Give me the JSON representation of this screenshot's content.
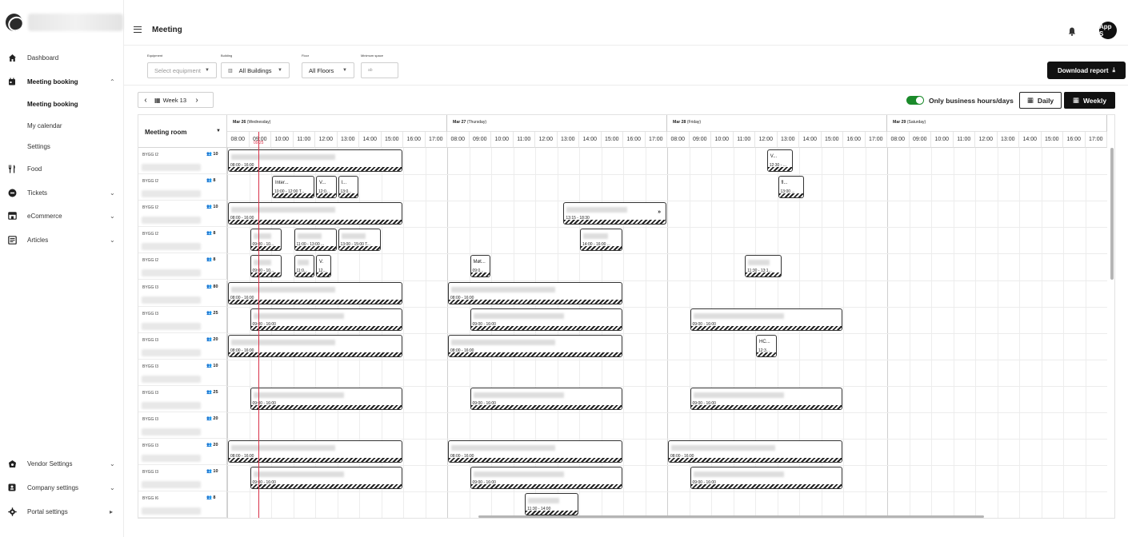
{
  "header": {
    "title": "Meeting",
    "avatar_text": "App S"
  },
  "sidebar": {
    "items": [
      {
        "label": "Dashboard",
        "icon": "home-icon",
        "chevron": ""
      },
      {
        "label": "Meeting booking",
        "icon": "calendar-icon",
        "chevron": "⌃"
      },
      {
        "label": "Meeting booking",
        "icon": "",
        "chevron": ""
      },
      {
        "label": "My calendar",
        "icon": "",
        "chevron": ""
      },
      {
        "label": "Settings",
        "icon": "",
        "chevron": ""
      },
      {
        "label": "Food",
        "icon": "utensils-icon",
        "chevron": ""
      },
      {
        "label": "Tickets",
        "icon": "ticket-icon",
        "chevron": "⌄"
      },
      {
        "label": "eCommerce",
        "icon": "store-icon",
        "chevron": "⌄"
      },
      {
        "label": "Articles",
        "icon": "articles-icon",
        "chevron": "⌄"
      },
      {
        "label": "Vendor Settings",
        "icon": "vendor-icon",
        "chevron": "⌄"
      },
      {
        "label": "Company settings",
        "icon": "company-icon",
        "chevron": "⌄"
      },
      {
        "label": "Portal settings",
        "icon": "gear-icon",
        "chevron": "▸"
      }
    ]
  },
  "filters": {
    "equipment_label": "Equipment",
    "equipment_placeholder": "Select equipment",
    "building_label": "Building",
    "building_value": "All Buildings",
    "floor_label": "Floor",
    "floor_value": "All Floors",
    "min_space_label": "Minimum space",
    "min_space_placeholder": "ab",
    "download_label": "Download report"
  },
  "toolbar": {
    "week_label": "Week 13",
    "business_hours_label": "Only business hours/days",
    "daily_label": "Daily",
    "weekly_label": "Weekly"
  },
  "calendar": {
    "room_header": "Meeting room",
    "now_label": "09:25",
    "days": [
      {
        "date": "Mar 26",
        "weekday": "(Wednesday)"
      },
      {
        "date": "Mar 27",
        "weekday": "(Thursday)"
      },
      {
        "date": "Mar 28",
        "weekday": "(Friday)"
      },
      {
        "date": "Mar 29",
        "weekday": "(Saturday)"
      }
    ],
    "hours": [
      "08:00",
      "09:00",
      "10:00",
      "11:00",
      "12:00",
      "13:00",
      "14:00",
      "15:00",
      "16:00",
      "17:00"
    ],
    "rooms": [
      {
        "building": "BYGG I2",
        "capacity": "10"
      },
      {
        "building": "BYGG I2",
        "capacity": "8"
      },
      {
        "building": "BYGG I2",
        "capacity": "10"
      },
      {
        "building": "BYGG I2",
        "capacity": "8"
      },
      {
        "building": "BYGG I2",
        "capacity": "8"
      },
      {
        "building": "BYGG I3",
        "capacity": "80"
      },
      {
        "building": "BYGG I3",
        "capacity": "25"
      },
      {
        "building": "BYGG I3",
        "capacity": "20"
      },
      {
        "building": "BYGG I3",
        "capacity": "10"
      },
      {
        "building": "BYGG I3",
        "capacity": "25"
      },
      {
        "building": "BYGG I3",
        "capacity": "20"
      },
      {
        "building": "BYGG I3",
        "capacity": "20"
      },
      {
        "building": "BYGG I3",
        "capacity": "10"
      },
      {
        "building": "BYGG I6",
        "capacity": "8"
      }
    ],
    "bookings": [
      {
        "row": 0,
        "day": 0,
        "start": 8,
        "end": 16,
        "title": "",
        "time": "08:00 - 16:00"
      },
      {
        "row": 0,
        "day": 2,
        "start": 12.5,
        "end": 13.75,
        "title": "V...",
        "time": "12:30 - ..."
      },
      {
        "row": 1,
        "day": 0,
        "start": 10,
        "end": 12,
        "title": "Inter...",
        "time": "10:00 - 12:00 T..."
      },
      {
        "row": 1,
        "day": 0,
        "start": 12,
        "end": 13,
        "title": "V...",
        "time": "12:0..."
      },
      {
        "row": 1,
        "day": 0,
        "start": 13,
        "end": 14,
        "title": "I...",
        "time": "13:0..."
      },
      {
        "row": 1,
        "day": 2,
        "start": 13,
        "end": 14.25,
        "title": "fl...",
        "time": "13:00 ..."
      },
      {
        "row": 2,
        "day": 0,
        "start": 8,
        "end": 16,
        "title": "",
        "time": "08:00 - 16:00"
      },
      {
        "row": 2,
        "day": 1,
        "start": 13.25,
        "end": 18,
        "title": "",
        "time": "13:15 - 18:30",
        "more": "»"
      },
      {
        "row": 3,
        "day": 0,
        "start": 9,
        "end": 10.5,
        "title": "",
        "time": "09:00 - 10..."
      },
      {
        "row": 3,
        "day": 0,
        "start": 11,
        "end": 13,
        "title": "",
        "time": "11:00 - 13:00 ..."
      },
      {
        "row": 3,
        "day": 0,
        "start": 13,
        "end": 15,
        "title": "",
        "time": "13:00 - 15:00 T..."
      },
      {
        "row": 3,
        "day": 1,
        "start": 14,
        "end": 16,
        "title": "",
        "time": "14:00 - 16:00 ..."
      },
      {
        "row": 4,
        "day": 0,
        "start": 9,
        "end": 10.5,
        "title": "",
        "time": "09:00 - 10..."
      },
      {
        "row": 4,
        "day": 0,
        "start": 11,
        "end": 12,
        "title": "",
        "time": "11:0..."
      },
      {
        "row": 4,
        "day": 0,
        "start": 12,
        "end": 12.75,
        "title": "V.",
        "time": "12..."
      },
      {
        "row": 4,
        "day": 1,
        "start": 9,
        "end": 10,
        "title": "Møt...",
        "time": "09:0..."
      },
      {
        "row": 4,
        "day": 2,
        "start": 11.5,
        "end": 13.25,
        "title": "",
        "time": "11:30 - 13:1..."
      },
      {
        "row": 5,
        "day": 0,
        "start": 8,
        "end": 16,
        "title": "",
        "time": "08:00 - 16:00"
      },
      {
        "row": 5,
        "day": 1,
        "start": 8,
        "end": 16,
        "title": "",
        "time": "08:00 - 16:00"
      },
      {
        "row": 6,
        "day": 0,
        "start": 9,
        "end": 16,
        "title": "",
        "time": "09:00 - 16:00"
      },
      {
        "row": 6,
        "day": 1,
        "start": 9,
        "end": 16,
        "title": "",
        "time": "09:00 - 16:00"
      },
      {
        "row": 6,
        "day": 2,
        "start": 9,
        "end": 16,
        "title": "",
        "time": "09:00 - 16:00"
      },
      {
        "row": 7,
        "day": 0,
        "start": 8,
        "end": 16,
        "title": "",
        "time": "08:00 - 16:00"
      },
      {
        "row": 7,
        "day": 1,
        "start": 8,
        "end": 16,
        "title": "",
        "time": "08:00 - 16:00"
      },
      {
        "row": 7,
        "day": 2,
        "start": 12,
        "end": 13,
        "title": "HC...",
        "time": "12:3..."
      },
      {
        "row": 9,
        "day": 0,
        "start": 9,
        "end": 16,
        "title": "",
        "time": "09:00 - 16:00"
      },
      {
        "row": 9,
        "day": 1,
        "start": 9,
        "end": 16,
        "title": "",
        "time": "09:00 - 16:00"
      },
      {
        "row": 9,
        "day": 2,
        "start": 9,
        "end": 16,
        "title": "",
        "time": "09:00 - 16:00"
      },
      {
        "row": 11,
        "day": 0,
        "start": 8,
        "end": 16,
        "title": "",
        "time": "08:00 - 16:00"
      },
      {
        "row": 11,
        "day": 1,
        "start": 8,
        "end": 16,
        "title": "",
        "time": "08:00 - 16:00"
      },
      {
        "row": 11,
        "day": 2,
        "start": 8,
        "end": 16,
        "title": "",
        "time": "08:00 - 16:00"
      },
      {
        "row": 12,
        "day": 0,
        "start": 9,
        "end": 16,
        "title": "",
        "time": "09:00 - 16:00"
      },
      {
        "row": 12,
        "day": 1,
        "start": 9,
        "end": 16,
        "title": "",
        "time": "09:00 - 16:00"
      },
      {
        "row": 12,
        "day": 2,
        "start": 9,
        "end": 16,
        "title": "",
        "time": "09:00 - 16:00"
      },
      {
        "row": 13,
        "day": 1,
        "start": 11.5,
        "end": 14,
        "title": "",
        "time": "11:30 - 14:00"
      }
    ]
  }
}
